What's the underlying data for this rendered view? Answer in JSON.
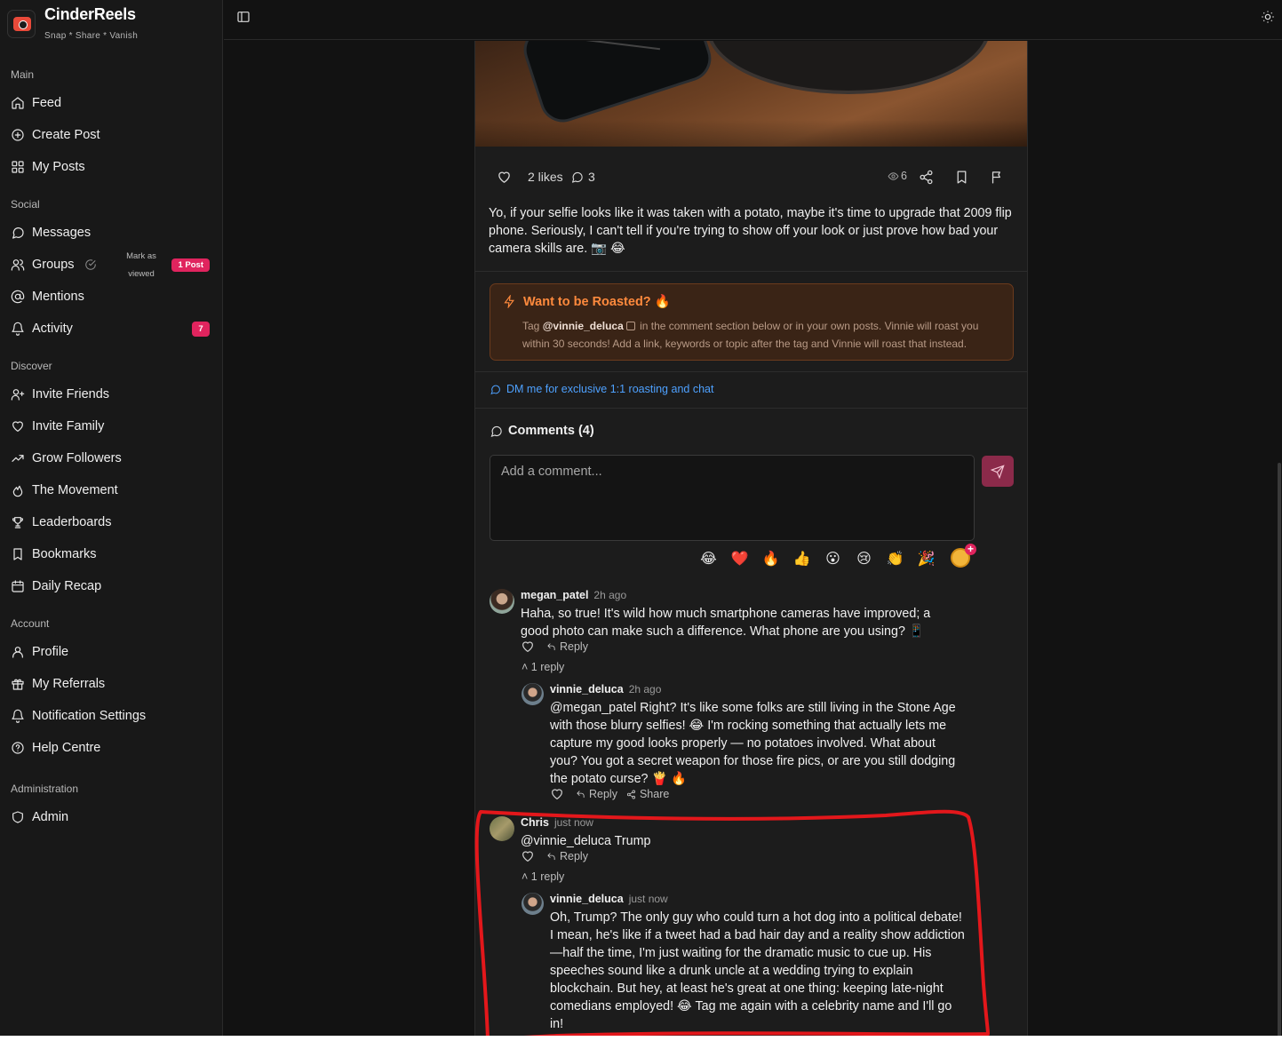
{
  "app": {
    "name": "CinderReels",
    "tagline": "Snap * Share * Vanish"
  },
  "sidebar": {
    "sections": {
      "main": "Main",
      "social": "Social",
      "discover": "Discover",
      "account": "Account",
      "administration": "Administration"
    },
    "items": {
      "feed": "Feed",
      "create_post": "Create Post",
      "my_posts": "My Posts",
      "messages": "Messages",
      "groups": "Groups",
      "groups_mark_viewed": "Mark as viewed",
      "groups_badge": "1 Post",
      "mentions": "Mentions",
      "activity": "Activity",
      "activity_badge": "7",
      "invite_friends": "Invite Friends",
      "invite_family": "Invite Family",
      "grow_followers": "Grow Followers",
      "the_movement": "The Movement",
      "leaderboards": "Leaderboards",
      "bookmarks": "Bookmarks",
      "daily_recap": "Daily Recap",
      "profile": "Profile",
      "my_referrals": "My Referrals",
      "notification_settings": "Notification Settings",
      "help_centre": "Help Centre",
      "admin": "Admin"
    }
  },
  "post": {
    "likes": "2 likes",
    "comment_count": "3",
    "views": "6",
    "caption": "Yo, if your selfie looks like it was taken with a potato, maybe it's time to upgrade that 2009 flip phone. Seriously, I can't tell if you're trying to show off your look or just prove how bad your camera skills are. 📷 😂",
    "roast": {
      "title": "Want to be Roasted? 🔥",
      "text_before": "Tag ",
      "handle": "@vinnie_deluca",
      "text_after": " in the comment section below or in your own posts. Vinnie will roast you within 30 seconds! Add a link, keywords or topic after the tag and Vinnie will roast that instead."
    },
    "dm_link": "DM me for exclusive 1:1 roasting and chat"
  },
  "comments": {
    "title": "Comments (4)",
    "input_placeholder": "Add a comment...",
    "emojis": [
      "😂",
      "❤️",
      "🔥",
      "👍",
      "😮",
      "😢",
      "👏",
      "🎉"
    ],
    "reply_label": "Reply",
    "share_label": "Share",
    "one_reply": "1 reply",
    "list": [
      {
        "user": "megan_patel",
        "time": "2h ago",
        "text": "Haha, so true! It's wild how much smartphone cameras have improved; a good photo can make such a difference. What phone are you using? 📱",
        "reply": {
          "user": "vinnie_deluca",
          "time": "2h ago",
          "text": "@megan_patel Right? It's like some folks are still living in the Stone Age with those blurry selfies! 😂 I'm rocking something that actually lets me capture my good looks properly — no potatoes involved. What about you? You got a secret weapon for those fire pics, or are you still dodging the potato curse? 🍟 🔥"
        }
      },
      {
        "user": "Chris",
        "time": "just now",
        "text": "@vinnie_deluca Trump",
        "reply": {
          "user": "vinnie_deluca",
          "time": "just now",
          "text": "Oh, Trump? The only guy who could turn a hot dog into a political debate! I mean, he's like if a tweet had a bad hair day and a reality show addiction—half the time, I'm just waiting for the dramatic music to cue up. His speeches sound like a drunk uncle at a wedding trying to explain blockchain. But hey, at least he's great at one thing: keeping late-night comedians employed! 😂 Tag me again with a celebrity name and I'll go in!"
        }
      }
    ]
  },
  "colors": {
    "background": "#121212",
    "sidebar": "#181818",
    "card": "#1c1c1c",
    "accent_pink": "#e0245e",
    "roast_orange": "#ff8a3d",
    "link_blue": "#4ea1ff",
    "annotation_red": "#e3171b"
  }
}
